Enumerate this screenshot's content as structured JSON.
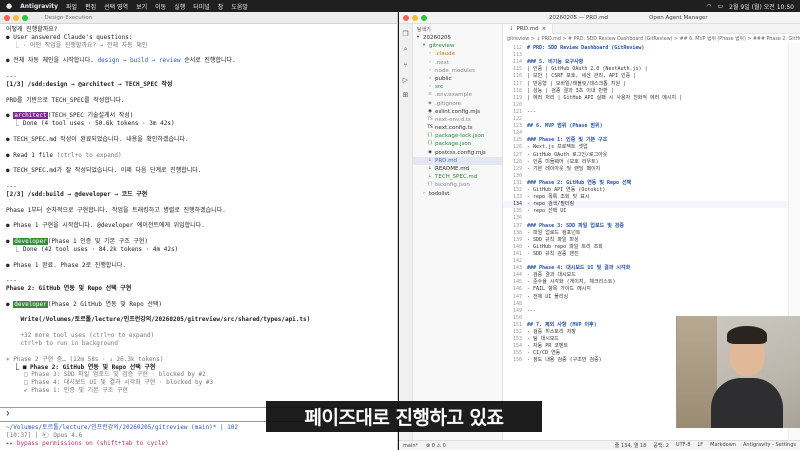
{
  "menubar": {
    "app": "Antigravity",
    "items": [
      "파일",
      "편집",
      "선택 영역",
      "보기",
      "이동",
      "실행",
      "터미널",
      "창",
      "도움말"
    ],
    "clock": "2월 9일 (월) 오전 10:50"
  },
  "terminal": {
    "title": "· Design Execution",
    "lines": [
      {
        "segments": [
          {
            "t": "어떻게 진행할까요?"
          }
        ]
      },
      {
        "segments": [
          {
            "t": "● User answered Claude's questions:"
          }
        ]
      },
      {
        "segments": [
          {
            "t": "  ⎿ · 어떤 작업을 진행할까요? → 전체 자동 체인",
            "c": "muted"
          }
        ]
      },
      {
        "segments": [
          {
            "t": ""
          }
        ]
      },
      {
        "segments": [
          {
            "t": "● 전체 자동 체인을 시작합니다. "
          },
          {
            "t": "design → build → review",
            "c": "blue"
          },
          {
            "t": " 순서로 진행합니다."
          }
        ]
      },
      {
        "segments": [
          {
            "t": ""
          }
        ]
      },
      {
        "segments": [
          {
            "t": "---"
          }
        ]
      },
      {
        "segments": [
          {
            "t": "[1/3] /sdd:design → @architect → TECH_SPEC 작성",
            "c": "bold"
          }
        ]
      },
      {
        "segments": [
          {
            "t": ""
          }
        ]
      },
      {
        "segments": [
          {
            "t": "PRD를 기반으로 TECH_SPEC를 작성합니다."
          }
        ]
      },
      {
        "segments": [
          {
            "t": ""
          }
        ]
      },
      {
        "segments": [
          {
            "t": "● "
          },
          {
            "t": "architect",
            "c": "tag-purple"
          },
          {
            "t": "(TECH_SPEC 기술설계서 작성)"
          }
        ]
      },
      {
        "segments": [
          {
            "t": "  ⎿ Done (4 tool uses · 50.6k tokens · 3m 42s)"
          }
        ]
      },
      {
        "segments": [
          {
            "t": ""
          }
        ]
      },
      {
        "segments": [
          {
            "t": "● TECH_SPEC.md 작성이 완료되었습니다. 내용을 확인하겠습니다."
          }
        ]
      },
      {
        "segments": [
          {
            "t": ""
          }
        ]
      },
      {
        "segments": [
          {
            "t": "● Read 1 file "
          },
          {
            "t": "(ctrl+o to expand)",
            "c": "muted"
          }
        ]
      },
      {
        "segments": [
          {
            "t": ""
          }
        ]
      },
      {
        "segments": [
          {
            "t": "● TECH_SPEC.md가 잘 작성되었습니다. 이제 다음 단계로 진행합니다."
          }
        ]
      },
      {
        "segments": [
          {
            "t": ""
          }
        ]
      },
      {
        "segments": [
          {
            "t": "---"
          }
        ]
      },
      {
        "segments": [
          {
            "t": "[2/3] /sdd:build → @developer → 코드 구현",
            "c": "bold"
          }
        ]
      },
      {
        "segments": [
          {
            "t": ""
          }
        ]
      },
      {
        "segments": [
          {
            "t": "Phase 1부터 순차적으로 구현합니다. 작업을 트래킹하고 병렬로 진행하겠습니다."
          }
        ]
      },
      {
        "segments": [
          {
            "t": ""
          }
        ]
      },
      {
        "segments": [
          {
            "t": "● Phase 1 구현을 시작합니다. @developer 에이전트에게 위임합니다."
          }
        ]
      },
      {
        "segments": [
          {
            "t": ""
          }
        ]
      },
      {
        "segments": [
          {
            "t": "● "
          },
          {
            "t": "developer",
            "c": "tag-green"
          },
          {
            "t": "(Phase 1 인증 및 기본 구조 구현)"
          }
        ]
      },
      {
        "segments": [
          {
            "t": "  ⎿ Done (42 tool uses · 84.2k tokens · 4m 42s)"
          }
        ]
      },
      {
        "segments": [
          {
            "t": ""
          }
        ]
      },
      {
        "segments": [
          {
            "t": "● Phase 1 완료. Phase 2로 진행합니다."
          }
        ]
      },
      {
        "segments": [
          {
            "t": ""
          }
        ]
      },
      {
        "segments": [
          {
            "t": "---"
          }
        ]
      },
      {
        "segments": [
          {
            "t": "Phase 2: GitHub 연동 및 Repo 선택 구현",
            "c": "bold"
          }
        ]
      },
      {
        "segments": [
          {
            "t": ""
          }
        ]
      },
      {
        "segments": [
          {
            "t": "● "
          },
          {
            "t": "developer",
            "c": "tag-green"
          },
          {
            "t": "(Phase 2 GitHub 연동 및 Repo 선택)"
          }
        ]
      },
      {
        "segments": [
          {
            "t": ""
          }
        ]
      },
      {
        "segments": [
          {
            "t": "    Write(/Volumes/토르툴/lecture/인프런강의/20260205/gitreview/src/shared/types/api.ts)",
            "c": "bold"
          }
        ]
      },
      {
        "segments": [
          {
            "t": ""
          }
        ]
      },
      {
        "segments": [
          {
            "t": "    +32 more tool uses (ctrl+o to expand)",
            "c": "muted"
          }
        ]
      },
      {
        "segments": [
          {
            "t": "    ctrl+b to run in background",
            "c": "muted"
          }
        ]
      },
      {
        "segments": [
          {
            "t": ""
          }
        ]
      },
      {
        "segments": [
          {
            "t": "✶ Phase 2 구현 중… (12m 58s · ↓ 26.3k tokens)",
            "c": "muted"
          }
        ]
      },
      {
        "segments": [
          {
            "t": "  ⎿ ■ Phase 2: GitHub 연동 및 Repo 선택 구현",
            "c": "bold"
          }
        ]
      },
      {
        "segments": [
          {
            "t": "     □ Phase 3: SDD 파일 업로드 및 검증 구현 · blocked by #2",
            "c": "muted"
          }
        ]
      },
      {
        "segments": [
          {
            "t": "     □ Phase 4: 대시보드 UI 및 결과 시각화 구현 · blocked by #3",
            "c": "muted"
          }
        ]
      },
      {
        "segments": [
          {
            "t": "     ✔ Phase 1: 인증 및 기본 구조 구현",
            "c": "muted"
          }
        ]
      }
    ],
    "prompt": "❯",
    "path_line": "~/Volumes/토르툴/lecture/인프런강의/20260205/gitreview (main)* | 102",
    "time_line": "[10:37] | 🐑 Opus 4.6",
    "bypass_line": "▸▸ bypass permissions on (shift+tab to cycle)"
  },
  "vscode": {
    "window_title": "20260205 — PRD.md",
    "agent_manager": "Open Agent Manager",
    "explorer_title": "탐색기",
    "tree": [
      {
        "name": "20260205",
        "icon": "▾",
        "cls": "",
        "indent": 0
      },
      {
        "name": "gitreview",
        "icon": "▾",
        "cls": "c-green",
        "indent": 1
      },
      {
        "name": ".claude",
        "icon": "›",
        "cls": "c-orange",
        "indent": 2
      },
      {
        "name": ".next",
        "icon": "›",
        "cls": "c-gray",
        "indent": 2
      },
      {
        "name": "node_modules",
        "icon": "›",
        "cls": "c-gray",
        "indent": 2
      },
      {
        "name": "public",
        "icon": "›",
        "cls": "",
        "indent": 2
      },
      {
        "name": "src",
        "icon": "›",
        "cls": "c-green",
        "indent": 2
      },
      {
        "name": ".env.example",
        "icon": "≡",
        "cls": "c-gray",
        "indent": 2
      },
      {
        "name": ".gitignore",
        "icon": "◆",
        "cls": "c-gray",
        "indent": 2
      },
      {
        "name": "eslint.config.mjs",
        "icon": "◉",
        "cls": "",
        "indent": 2
      },
      {
        "name": "next-env.d.ts",
        "icon": "TS",
        "cls": "c-gray",
        "indent": 2
      },
      {
        "name": "next.config.ts",
        "icon": "TS",
        "cls": "",
        "indent": 2
      },
      {
        "name": "package-lock.json",
        "icon": "{}",
        "cls": "c-green",
        "indent": 2
      },
      {
        "name": "package.json",
        "icon": "{}",
        "cls": "c-green",
        "indent": 2
      },
      {
        "name": "postcss.config.mjs",
        "icon": "◉",
        "cls": "",
        "indent": 2
      },
      {
        "name": "PRD.md",
        "icon": "↓",
        "cls": "c-blue",
        "indent": 2,
        "selected": true
      },
      {
        "name": "README.md",
        "icon": "↓",
        "cls": "",
        "indent": 2
      },
      {
        "name": "TECH_SPEC.md",
        "icon": "↓",
        "cls": "c-green",
        "indent": 2
      },
      {
        "name": "tsconfig.json",
        "icon": "{}",
        "cls": "c-gray",
        "indent": 2
      },
      {
        "name": "todolist",
        "icon": "›",
        "cls": "",
        "indent": 1
      }
    ],
    "tab_label": "PRD.md",
    "breadcrumb": "gitreview > ↓ PRD.md > # PRD: SDD Review Dashboard (GitReview) > ## 6. MVP 범위 (Phase 범위) > ### Phase 2: GitHub 연동 및 Re",
    "code": [
      {
        "n": "112",
        "t": "# PRD: SDD Review Dashboard (GitReview)",
        "h": true
      },
      {
        "n": "113",
        "t": ""
      },
      {
        "n": "114",
        "t": "### 5. 비기능 요구사항",
        "h": true
      },
      {
        "n": "115",
        "t": "| 인증 | GitHub OAuth 2.0 (NextAuth.js) |"
      },
      {
        "n": "116",
        "t": "| 보안 | CSRF 보호, 세션 관리, API 인증 |"
      },
      {
        "n": "117",
        "t": "| 반응형 | 모바일/태블릿/데스크톱 지원 |"
      },
      {
        "n": "118",
        "t": "| 성능 | 검증 결과 3초 이내 반환 |"
      },
      {
        "n": "119",
        "t": "| 에러 처리 | GitHub API 실패 시 사용자 친화적 에러 메시지 |"
      },
      {
        "n": "120",
        "t": ""
      },
      {
        "n": "121",
        "t": "---"
      },
      {
        "n": "122",
        "t": ""
      },
      {
        "n": "123",
        "t": "## 6. MVP 범위 (Phase 범위)",
        "h": true
      },
      {
        "n": "124",
        "t": ""
      },
      {
        "n": "125",
        "t": "### Phase 1: 인증 및 기본 구조",
        "h": true
      },
      {
        "n": "126",
        "t": "- Next.js 프로젝트 셋업"
      },
      {
        "n": "127",
        "t": "- GitHub OAuth 로그인/로그아웃"
      },
      {
        "n": "128",
        "t": "- 인증 미들웨어 (보호 라우트)"
      },
      {
        "n": "129",
        "t": "- 기본 레이아웃 및 랜딩 페이지"
      },
      {
        "n": "130",
        "t": ""
      },
      {
        "n": "131",
        "t": "### Phase 2: GitHub 연동 및 Repo 선택",
        "h": true
      },
      {
        "n": "132",
        "t": "- GitHub API 연동 (Octokit)"
      },
      {
        "n": "133",
        "t": "- repo 목록 조회 및 표시"
      },
      {
        "n": "134",
        "t": "- repo 검색/필터링",
        "cur": true
      },
      {
        "n": "135",
        "t": "- repo 선택 UI"
      },
      {
        "n": "136",
        "t": ""
      },
      {
        "n": "137",
        "t": "### Phase 3: SDD 파일 업로드 및 검증",
        "h": true
      },
      {
        "n": "138",
        "t": "- 파일 업로드 컴포넌트"
      },
      {
        "n": "139",
        "t": "- SDD 규칙 파일 파싱"
      },
      {
        "n": "140",
        "t": "- GitHub repo 파일 트리 조회"
      },
      {
        "n": "141",
        "t": "- SDD 규칙 검증 엔진"
      },
      {
        "n": "142",
        "t": ""
      },
      {
        "n": "143",
        "t": "### Phase 4: 대시보드 UI 및 결과 시각화",
        "h": true
      },
      {
        "n": "144",
        "t": "- 검증 결과 대시보드"
      },
      {
        "n": "145",
        "t": "- 준수율 시각화 (게이지, 체크리스트)"
      },
      {
        "n": "146",
        "t": "- FAIL 항목 가이드 메시지"
      },
      {
        "n": "147",
        "t": "- 전체 UI 폴리싱"
      },
      {
        "n": "148",
        "t": ""
      },
      {
        "n": "149",
        "t": "---"
      },
      {
        "n": "150",
        "t": ""
      },
      {
        "n": "151",
        "t": "## 7. 제외 사항 (MVP 이후)",
        "h": true
      },
      {
        "n": "152",
        "t": "- 검증 히스토리 저장"
      },
      {
        "n": "153",
        "t": "- 팀 대시보드"
      },
      {
        "n": "154",
        "t": "- 자동 PR 코멘트"
      },
      {
        "n": "155",
        "t": "- CI/CD 연동"
      },
      {
        "n": "156",
        "t": "- 정도 내용 검증 (구조만 검증)"
      }
    ],
    "status": {
      "branch": "main*",
      "errors": "⊗ 0 ⚠ 0",
      "position": "줄 134, 열 18",
      "spaces": "공백: 2",
      "encoding": "UTF-8",
      "eol": "LF",
      "language": "Markdown",
      "settings": "Antigravity - Settings"
    }
  },
  "subtitle": "페이즈대로 진행하고 있죠"
}
